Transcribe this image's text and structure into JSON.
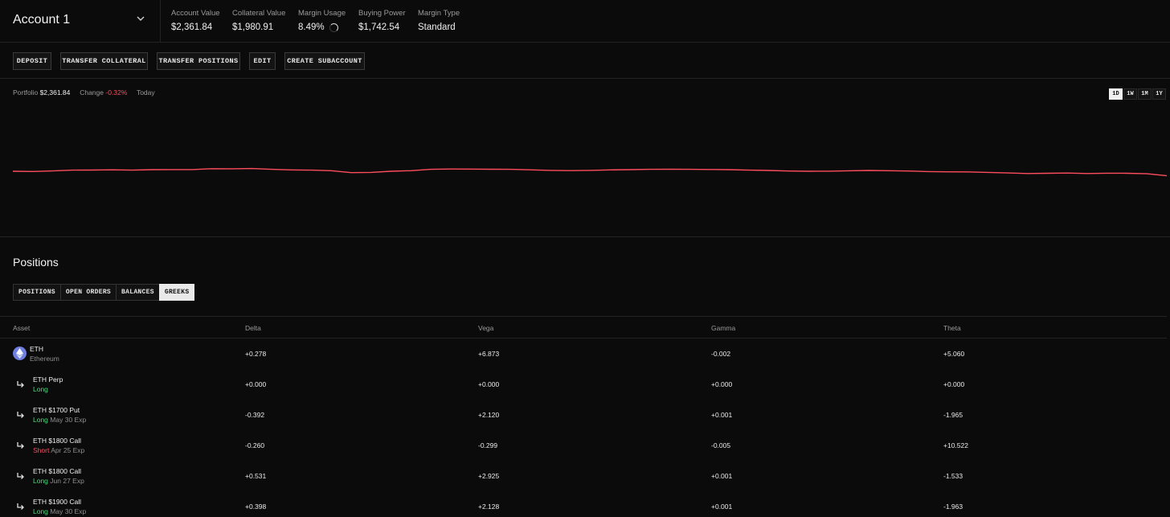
{
  "header": {
    "account_name": "Account 1",
    "stats": [
      {
        "label": "Account Value",
        "value": "$2,361.84"
      },
      {
        "label": "Collateral Value",
        "value": "$1,980.91"
      },
      {
        "label": "Margin Usage",
        "value": "8.49%"
      },
      {
        "label": "Buying Power",
        "value": "$1,742.54"
      },
      {
        "label": "Margin Type",
        "value": "Standard"
      }
    ]
  },
  "actions": [
    "DEPOSIT",
    "TRANSFER COLLATERAL",
    "TRANSFER POSITIONS",
    "EDIT",
    "CREATE SUBACCOUNT"
  ],
  "portfolio": {
    "label": "Portfolio",
    "value": "$2,361.84",
    "change_label": "Change",
    "change_value": "-0.32%",
    "period_label": "Today",
    "ranges": [
      "1D",
      "1W",
      "1M",
      "1Y"
    ],
    "active_range": "1D"
  },
  "chart_data": {
    "type": "line",
    "series": [
      {
        "values": [
          0.5,
          0.52,
          0.47,
          0.4,
          0.39,
          0.37,
          0.4,
          0.36,
          0.35,
          0.35,
          0.27,
          0.28,
          0.26,
          0.33,
          0.38,
          0.4,
          0.45,
          0.62,
          0.6,
          0.5,
          0.45,
          0.33,
          0.3,
          0.31,
          0.32,
          0.33,
          0.37,
          0.42,
          0.44,
          0.42,
          0.38,
          0.36,
          0.33,
          0.32,
          0.33,
          0.34,
          0.36,
          0.4,
          0.43,
          0.48,
          0.5,
          0.49,
          0.46,
          0.43,
          0.45,
          0.48,
          0.53,
          0.55,
          0.56,
          0.6,
          0.65,
          0.7,
          0.68,
          0.66,
          0.7,
          0.67,
          0.68,
          0.72,
          0.9
        ],
        "color": "#ff4d5e"
      }
    ],
    "grid": false,
    "legend": "none"
  },
  "positions": {
    "title": "Positions",
    "tabs": [
      "POSITIONS",
      "OPEN ORDERS",
      "BALANCES",
      "GREEKS"
    ],
    "active_tab": "GREEKS",
    "columns": [
      "Asset",
      "Delta",
      "Vega",
      "Gamma",
      "Theta"
    ],
    "rows": [
      {
        "name": "ETH",
        "sub": "Ethereum",
        "side": "",
        "exp": "",
        "delta": "+0.278",
        "vega": "+6.873",
        "gamma": "-0.002",
        "theta": "+5.060"
      },
      {
        "name": "ETH Perp",
        "sub": "",
        "side": "Long",
        "exp": "",
        "delta": "+0.000",
        "vega": "+0.000",
        "gamma": "+0.000",
        "theta": "+0.000"
      },
      {
        "name": "ETH $1700 Put",
        "sub": "",
        "side": "Long",
        "exp": "May 30 Exp",
        "delta": "-0.392",
        "vega": "+2.120",
        "gamma": "+0.001",
        "theta": "-1.965"
      },
      {
        "name": "ETH $1800 Call",
        "sub": "",
        "side": "Short",
        "exp": "Apr 25 Exp",
        "delta": "-0.260",
        "vega": "-0.299",
        "gamma": "-0.005",
        "theta": "+10.522"
      },
      {
        "name": "ETH $1800 Call",
        "sub": "",
        "side": "Long",
        "exp": "Jun 27 Exp",
        "delta": "+0.531",
        "vega": "+2.925",
        "gamma": "+0.001",
        "theta": "-1.533"
      },
      {
        "name": "ETH $1900 Call",
        "sub": "",
        "side": "Long",
        "exp": "May 30 Exp",
        "delta": "+0.398",
        "vega": "+2.128",
        "gamma": "+0.001",
        "theta": "-1.963"
      }
    ]
  },
  "icons": {
    "account_dropdown": "chevron-down-icon",
    "asset": "ethereum-icon",
    "sub_position": "sub-arrow-icon",
    "margin_usage": "spinner-icon"
  }
}
